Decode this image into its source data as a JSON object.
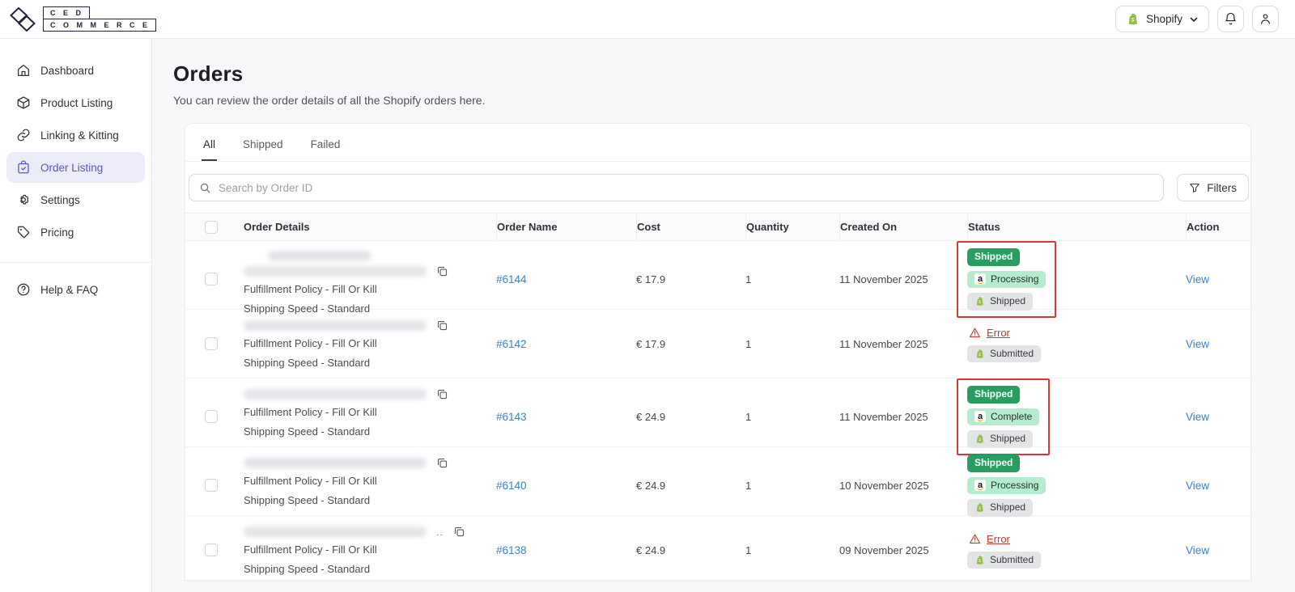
{
  "header": {
    "logo": {
      "line1": "C E D",
      "line2": "C O M M E R C E"
    },
    "store_switcher": {
      "label": "Shopify"
    }
  },
  "sidebar": {
    "items": [
      {
        "label": "Dashboard",
        "icon": "home-icon",
        "active": false
      },
      {
        "label": "Product Listing",
        "icon": "cube-icon",
        "active": false
      },
      {
        "label": "Linking & Kitting",
        "icon": "link-icon",
        "active": false
      },
      {
        "label": "Order Listing",
        "icon": "order-bag-icon",
        "active": true
      },
      {
        "label": "Settings",
        "icon": "gear-icon",
        "active": false
      },
      {
        "label": "Pricing",
        "icon": "tag-icon",
        "active": false
      }
    ],
    "footer_item": {
      "label": "Help & FAQ",
      "icon": "question-icon"
    }
  },
  "page": {
    "title": "Orders",
    "subtitle": "You can review the order details of all the Shopify orders here."
  },
  "tabs": [
    {
      "label": "All",
      "active": true
    },
    {
      "label": "Shipped",
      "active": false
    },
    {
      "label": "Failed",
      "active": false
    }
  ],
  "toolbar": {
    "search_placeholder": "Search by Order ID",
    "filters_label": "Filters"
  },
  "table": {
    "columns": [
      "Order Details",
      "Order Name",
      "Cost",
      "Quantity",
      "Created On",
      "Status",
      "Action"
    ],
    "rows": [
      {
        "customer_redacted": true,
        "blur_lines": 2,
        "truncated": false,
        "fulfillment_policy": "Fulfillment Policy - Fill Or Kill",
        "shipping_speed": "Shipping Speed - Standard",
        "order_name": "#6144",
        "cost": "€ 17.9",
        "quantity": "1",
        "created_on": "11 November 2025",
        "statuses": [
          {
            "type": "solid-green",
            "label": "Shipped"
          },
          {
            "type": "amazon",
            "label": "Processing"
          },
          {
            "type": "shopify",
            "label": "Shipped"
          }
        ],
        "status_highlighted": true,
        "action": "View"
      },
      {
        "customer_redacted": true,
        "blur_lines": 1,
        "truncated": false,
        "fulfillment_policy": "Fulfillment Policy - Fill Or Kill",
        "shipping_speed": "Shipping Speed - Standard",
        "order_name": "#6142",
        "cost": "€ 17.9",
        "quantity": "1",
        "created_on": "11 November 2025",
        "statuses": [
          {
            "type": "error",
            "label": "Error"
          },
          {
            "type": "shopify",
            "label": "Submitted"
          }
        ],
        "status_highlighted": false,
        "action": "View"
      },
      {
        "customer_redacted": true,
        "blur_lines": 1,
        "truncated": false,
        "fulfillment_policy": "Fulfillment Policy - Fill Or Kill",
        "shipping_speed": "Shipping Speed - Standard",
        "order_name": "#6143",
        "cost": "€ 24.9",
        "quantity": "1",
        "created_on": "11 November 2025",
        "statuses": [
          {
            "type": "solid-green",
            "label": "Shipped"
          },
          {
            "type": "amazon",
            "label": "Complete"
          },
          {
            "type": "shopify",
            "label": "Shipped"
          }
        ],
        "status_highlighted": true,
        "action": "View"
      },
      {
        "customer_redacted": true,
        "blur_lines": 1,
        "truncated": false,
        "fulfillment_policy": "Fulfillment Policy - Fill Or Kill",
        "shipping_speed": "Shipping Speed - Standard",
        "order_name": "#6140",
        "cost": "€ 24.9",
        "quantity": "1",
        "created_on": "10 November 2025",
        "statuses": [
          {
            "type": "solid-green",
            "label": "Shipped"
          },
          {
            "type": "amazon",
            "label": "Processing"
          },
          {
            "type": "shopify",
            "label": "Shipped"
          }
        ],
        "status_highlighted": false,
        "action": "View"
      },
      {
        "customer_redacted": true,
        "blur_lines": 1,
        "truncated": true,
        "fulfillment_policy": "Fulfillment Policy - Fill Or Kill",
        "shipping_speed": "Shipping Speed - Standard",
        "order_name": "#6138",
        "cost": "€ 24.9",
        "quantity": "1",
        "created_on": "09 November 2025",
        "statuses": [
          {
            "type": "error",
            "label": "Error"
          },
          {
            "type": "shopify",
            "label": "Submitted"
          }
        ],
        "status_highlighted": false,
        "action": "View"
      }
    ]
  },
  "colors": {
    "accent_purple": "#5b55c0",
    "link_blue": "#3a82c9",
    "badge_green": "#279e60",
    "badge_mint": "#b5ebce",
    "badge_gray": "#e3e4e6",
    "error_red": "#bf3a32",
    "highlight_red": "#d23b35",
    "shopify_green": "#95bf47"
  }
}
